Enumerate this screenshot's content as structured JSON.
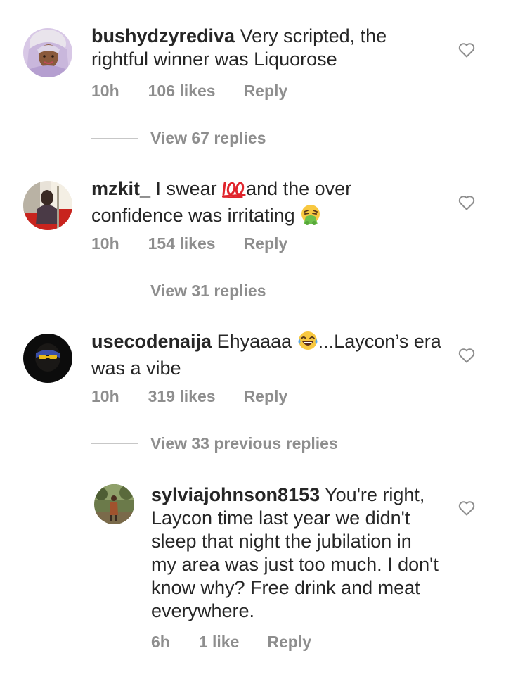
{
  "comments": [
    {
      "username": "bushydzyrediva",
      "text": " Very scripted, the rightful winner was Liquorose",
      "time": "10h",
      "likes": "106 likes",
      "reply": "Reply",
      "view_replies": "View 67 replies"
    },
    {
      "username": "mzkit_",
      "text_1": " I swear ",
      "emoji_1": "hundred-points-icon",
      "text_2": "and the over confidence was irritating ",
      "emoji_2": "vomiting-face-icon",
      "time": "10h",
      "likes": "154 likes",
      "reply": "Reply",
      "view_replies": "View 31 replies"
    },
    {
      "username": "usecodenaija",
      "text_1": " Ehyaaaa ",
      "emoji_1": "tears-of-joy-icon",
      "text_2": "...Laycon’s era was a vibe",
      "time": "10h",
      "likes": "319 likes",
      "reply": "Reply",
      "view_replies": "View 33 previous replies"
    },
    {
      "username": "sylviajohnson8153",
      "text": " You're right, Laycon time  last year  we didn't sleep that night the jubilation in my area was just too much. I don't know why? Free drink and meat everywhere.",
      "time": "6h",
      "likes": "1 like",
      "reply": "Reply"
    }
  ],
  "colors": {
    "text": "#262626",
    "secondary": "#8e8e8e",
    "divider": "#c7c7c7"
  }
}
